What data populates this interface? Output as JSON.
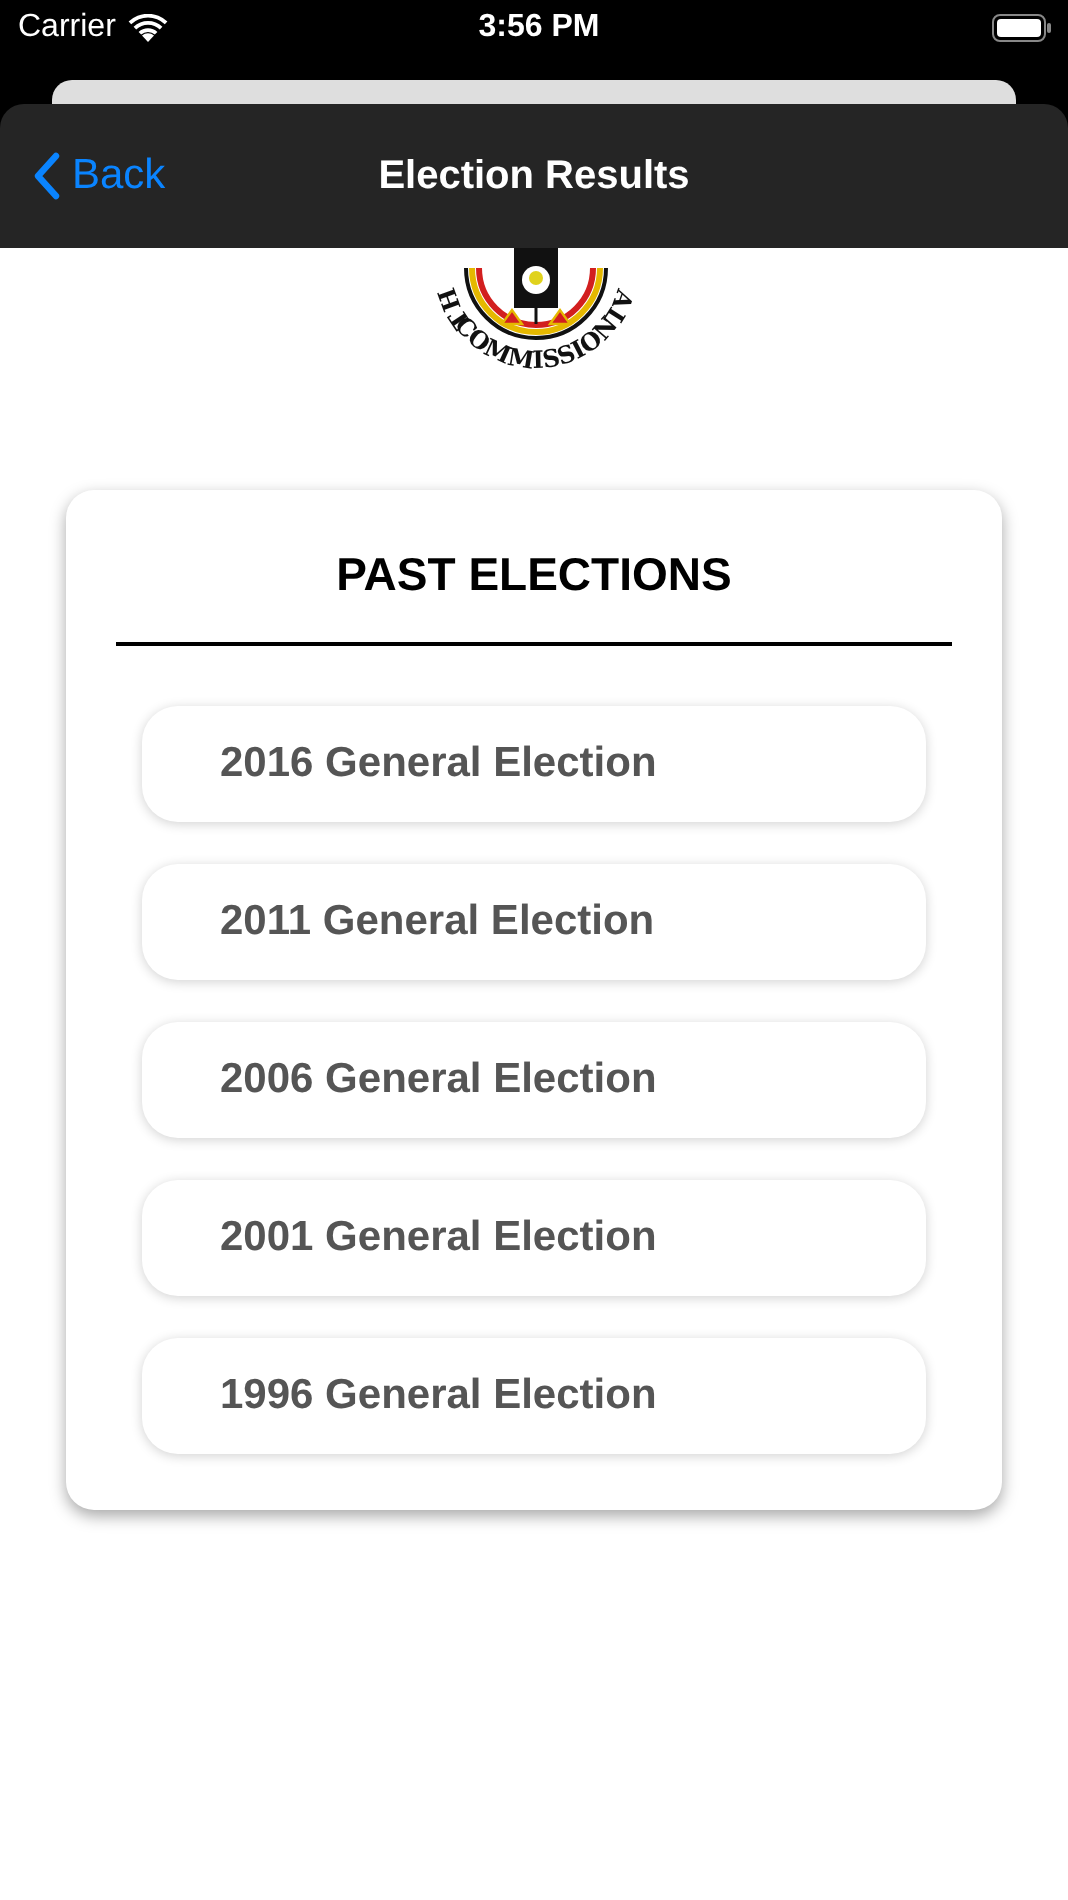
{
  "status_bar": {
    "carrier": "Carrier",
    "time": "3:56 PM"
  },
  "nav": {
    "back": "Back",
    "title": "Election Results"
  },
  "logo": {
    "left_text": "TH",
    "right_text": "AL",
    "bottom_text": "COMMISSION"
  },
  "card": {
    "title": "PAST ELECTIONS",
    "items": [
      {
        "label": "2016 General Election"
      },
      {
        "label": "2011 General Election"
      },
      {
        "label": "2006 General Election"
      },
      {
        "label": "2001 General Election"
      },
      {
        "label": "1996 General Election"
      }
    ]
  }
}
